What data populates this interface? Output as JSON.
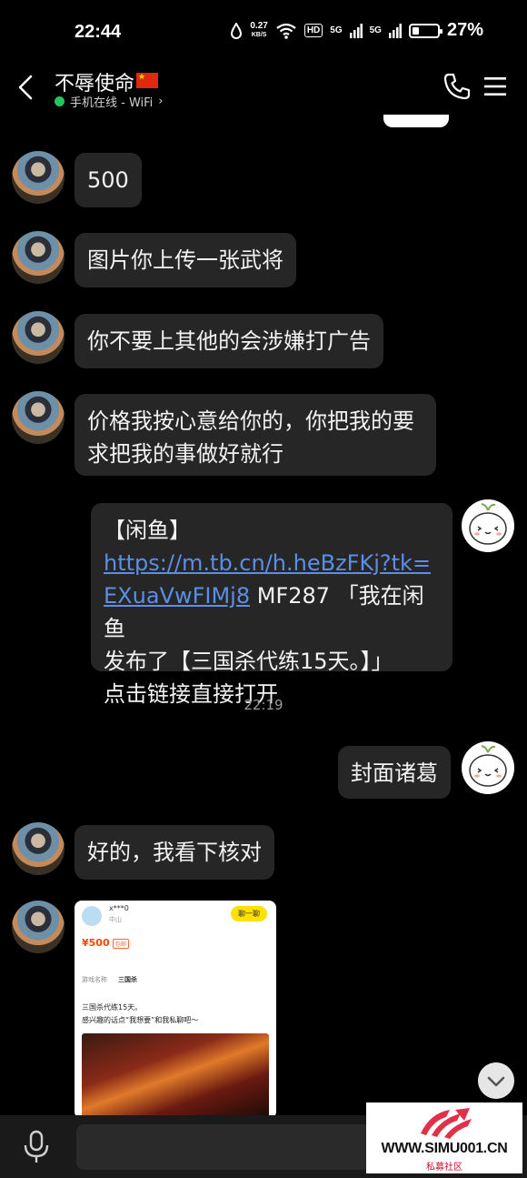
{
  "status_bar": {
    "time": "22:44",
    "speed_value": "0.27",
    "speed_unit": "KB/S",
    "hd_badge": "HD",
    "net1": "5G",
    "net2": "5G",
    "battery_percent": "27%",
    "battery_level": 0.27
  },
  "header": {
    "contact_name": "不辱使命",
    "online_status": "手机在线 - WiFi",
    "chevron": "›"
  },
  "messages": [
    {
      "sender": "friend",
      "text": "500"
    },
    {
      "sender": "friend",
      "text": "图片你上传一张武将"
    },
    {
      "sender": "friend",
      "text": "你不要上其他的会涉嫌打广告"
    },
    {
      "sender": "friend",
      "line1": "价格我按心意给你的，你把我的要",
      "line2": "求把我的事做好就行"
    },
    {
      "sender": "me",
      "line1": "【闲鱼】",
      "link_part1": "https://m.tb.cn/h.heBzFKj?tk=",
      "link_part2": "EXuaVwFIMj8",
      "line3_rest": " MF287 「我在闲鱼",
      "line4": "发布了【三国杀代练15天。】」",
      "line5": "点击链接直接打开"
    },
    {
      "sender": "me",
      "text": "封面诸葛"
    },
    {
      "sender": "friend",
      "text": "好的，我看下核对"
    }
  ],
  "timestamp": "22:19",
  "image_card": {
    "user": "x***0",
    "location": "中山",
    "chat_button": "聊一聊",
    "price": "¥500",
    "tag": "包邮",
    "game_label": "游戏名称",
    "game_value": "三国杀",
    "desc1": "三国杀代练15天。",
    "desc2": "感兴趣的话点“我想要”和我私聊吧～"
  },
  "watermark": {
    "url": "WWW.SIMU001.CN",
    "subtitle": "私募社区"
  }
}
